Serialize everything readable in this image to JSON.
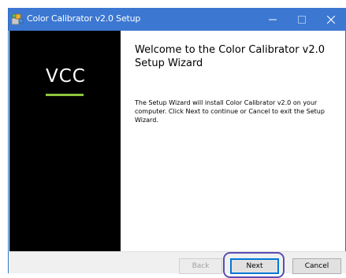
{
  "window": {
    "title": "Color Calibrator v2.0 Setup"
  },
  "titlebar": {
    "app_icon": "installer-icon",
    "minimize_icon": "minimize-icon",
    "maximize_icon": "maximize-icon",
    "close_icon": "close-icon"
  },
  "sidebar": {
    "logo_text": "VCC",
    "accent_color": "#8dc63f",
    "background_color": "#000000"
  },
  "content": {
    "heading": "Welcome to the Color Calibrator v2.0 Setup Wizard",
    "body": "The Setup Wizard will install Color Calibrator v2.0 on your computer. Click Next to continue or Cancel to exit the Setup Wizard."
  },
  "buttons": {
    "back_label": "Back",
    "next_label": "Next",
    "cancel_label": "Cancel",
    "back_enabled": false
  },
  "colors": {
    "titlebar": "#3c78d2",
    "highlight_ring": "#5a4fb2",
    "default_button_border": "#0078d7"
  }
}
